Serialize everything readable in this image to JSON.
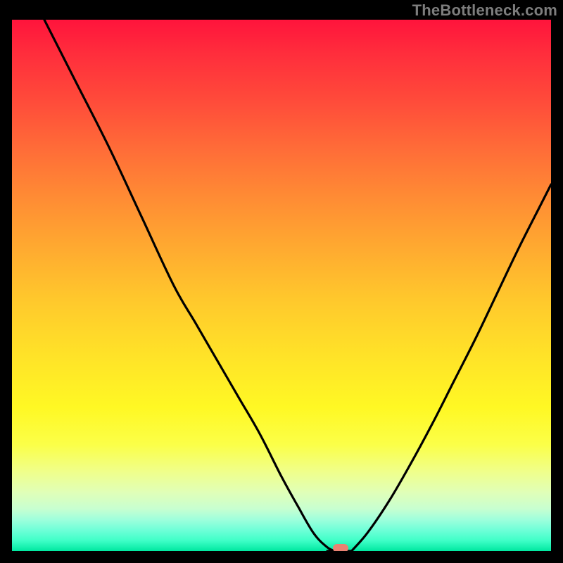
{
  "attribution": "TheBottleneck.com",
  "colors": {
    "curve": "#000000",
    "marker": "#e98272",
    "gradient_top": "#ff143c",
    "gradient_bottom": "#00e8a0",
    "background": "#000000"
  },
  "chart_data": {
    "type": "line",
    "title": "",
    "xlabel": "",
    "ylabel": "",
    "xlim": [
      0,
      100
    ],
    "ylim": [
      0,
      100
    ],
    "grid": false,
    "annotations": [
      {
        "name": "optimal-marker",
        "x": 61,
        "y": 0.5,
        "color": "#e98272"
      }
    ],
    "series": [
      {
        "name": "left-branch",
        "x": [
          6,
          12,
          18,
          24,
          30,
          34,
          38,
          42,
          46,
          50,
          53,
          56,
          58.5,
          60
        ],
        "values": [
          100,
          88,
          76,
          63,
          50,
          43,
          36,
          29,
          22,
          14,
          8.5,
          3.3,
          0.7,
          0
        ]
      },
      {
        "name": "valley-floor",
        "x": [
          58.5,
          63
        ],
        "values": [
          0,
          0
        ]
      },
      {
        "name": "right-branch",
        "x": [
          63,
          66,
          70,
          74,
          78,
          82,
          86,
          90,
          94,
          98,
          100
        ],
        "values": [
          0,
          3.5,
          9.5,
          16.5,
          24,
          32,
          40,
          48.5,
          57,
          65,
          69
        ]
      }
    ]
  }
}
